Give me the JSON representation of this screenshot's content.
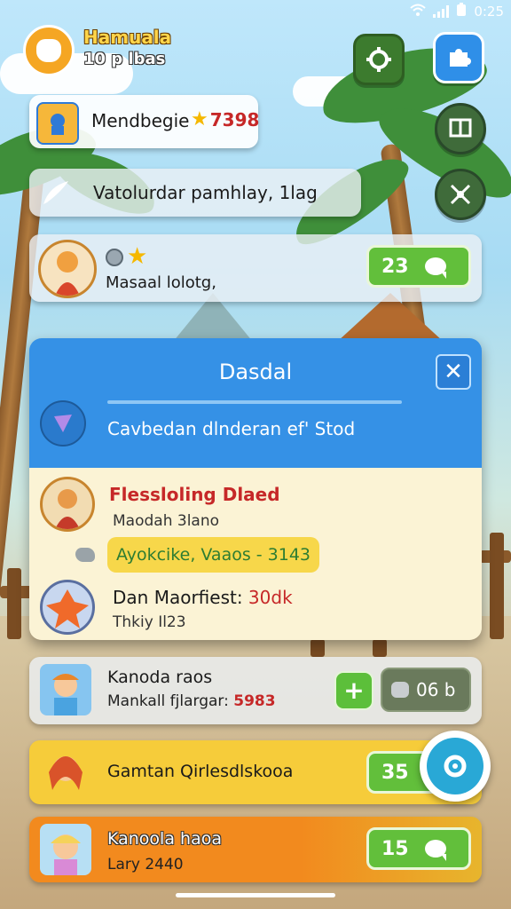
{
  "status_bar": {
    "time": "0:25"
  },
  "player": {
    "name": "Hamuala",
    "subtitle": "10 p lbas"
  },
  "top_card": {
    "label": "Mendbegie",
    "star_value": "7398"
  },
  "notice": {
    "text": "Vatolurdar pamhlay, 1lag"
  },
  "character_card": {
    "text": "Masaal lolotg,",
    "count": "23"
  },
  "modal": {
    "title": "Dasdal",
    "subtitle": "Cavbedan dlnderan ef' Stod",
    "entry1": {
      "name": "Flessloling Dlaed",
      "sub": "Maodah 3lano"
    },
    "highlight": "Ayokcike, Vaaos - 3143",
    "entry2": {
      "name_prefix": "Dan Maorfiest:",
      "name_value": "30dk",
      "sub": "Thkiy Il23"
    }
  },
  "list": [
    {
      "title": "Kanoda raos",
      "sub_prefix": "Mankall fjlargar:",
      "sub_value": "5983",
      "right_value": "06 b"
    },
    {
      "title": "Gamtan Qirlesdlskooa",
      "count": "35"
    },
    {
      "title": "Kanoola haoa",
      "sub": "Lary 2440",
      "count": "15"
    }
  ],
  "colors": {
    "accent_blue": "#3591e6",
    "accent_green": "#62bf3b",
    "gold": "#ffd54a",
    "orange_card": "#f28a1e",
    "yellow_card": "#f6cc3a"
  },
  "icons": [
    "apple-icon",
    "gear-icon",
    "puzzle-icon",
    "board-icon",
    "tools-icon",
    "star-icon",
    "chat-bubble-icon",
    "close-icon",
    "feather-icon",
    "plus-icon",
    "helmet-icon",
    "gear-badge-icon"
  ]
}
